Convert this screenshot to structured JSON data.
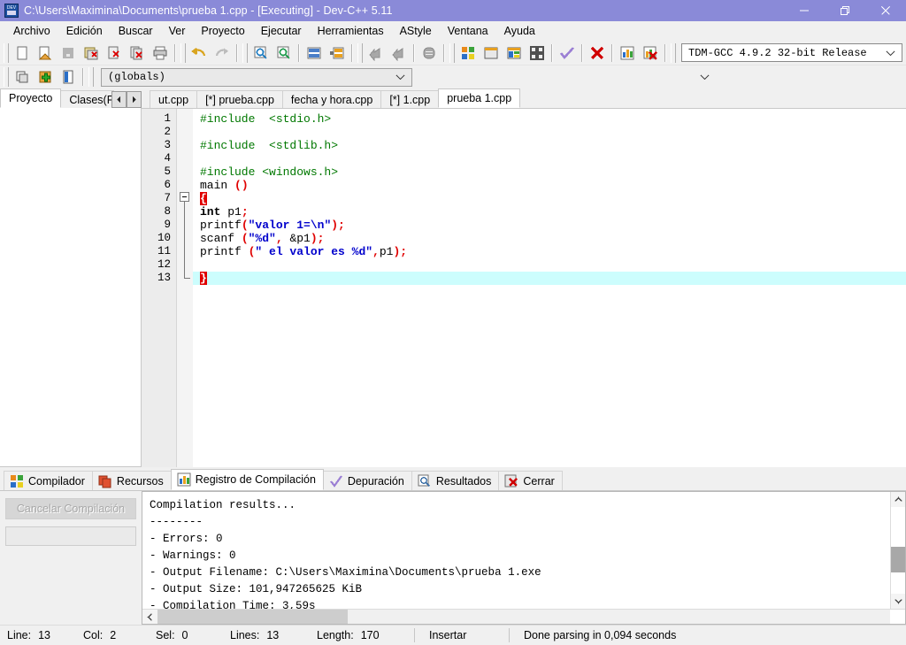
{
  "window": {
    "title": "C:\\Users\\Maximina\\Documents\\prueba 1.cpp - [Executing] - Dev-C++ 5.11",
    "icon": "devcpp-icon",
    "minimize": "minimize-button",
    "restore": "restore-button",
    "close": "close-button"
  },
  "menu": {
    "items": [
      {
        "label": "Archivo"
      },
      {
        "label": "Edición"
      },
      {
        "label": "Buscar"
      },
      {
        "label": "Ver"
      },
      {
        "label": "Proyecto"
      },
      {
        "label": "Ejecutar"
      },
      {
        "label": "Herramientas"
      },
      {
        "label": "AStyle"
      },
      {
        "label": "Ventana"
      },
      {
        "label": "Ayuda"
      }
    ]
  },
  "toolbar": {
    "buttons": [
      {
        "name": "new-file-icon",
        "enabled": true
      },
      {
        "name": "open-file-icon",
        "enabled": true
      },
      {
        "name": "save-file-icon",
        "enabled": false
      },
      {
        "name": "save-all-icon",
        "enabled": true
      },
      {
        "name": "close-file-icon",
        "enabled": true
      },
      {
        "name": "close-all-icon",
        "enabled": true
      },
      {
        "name": "print-icon",
        "enabled": true
      },
      {
        "name": "undo-icon",
        "enabled": true
      },
      {
        "name": "redo-icon",
        "enabled": false
      },
      {
        "name": "find-icon",
        "enabled": true
      },
      {
        "name": "replace-icon",
        "enabled": true
      },
      {
        "name": "goto-line-icon",
        "enabled": true
      },
      {
        "name": "goto-function-icon",
        "enabled": true
      },
      {
        "name": "back-icon",
        "enabled": false
      },
      {
        "name": "forward-icon",
        "enabled": false
      },
      {
        "name": "toggle-bookmark-icon",
        "enabled": false
      },
      {
        "name": "compile-icon",
        "enabled": true
      },
      {
        "name": "run-icon",
        "enabled": true
      },
      {
        "name": "compile-and-run-icon",
        "enabled": true
      },
      {
        "name": "rebuild-all-icon",
        "enabled": true
      },
      {
        "name": "syntax-check-icon",
        "enabled": true
      },
      {
        "name": "stop-execution-icon",
        "enabled": true
      },
      {
        "name": "profile-icon",
        "enabled": true
      },
      {
        "name": "delete-profile-icon",
        "enabled": true
      }
    ],
    "compiler_label": "TDM-GCC 4.9.2 32-bit Release",
    "compiler_arrow": "chevron-down-icon"
  },
  "toolbar2": {
    "buttons": [
      {
        "name": "new-project-icon"
      },
      {
        "name": "add-to-project-icon"
      },
      {
        "name": "project-options-icon"
      }
    ],
    "scope_label": "(globals)",
    "scope_arrow": "chevron-down-icon",
    "member_label": "",
    "member_arrow": "chevron-down-icon"
  },
  "left_panel": {
    "tabs": [
      {
        "label": "Proyecto",
        "active": true
      },
      {
        "label": "Clases(Fun",
        "active": false
      }
    ],
    "scroll_left": "◄",
    "scroll_right": "►"
  },
  "editor": {
    "tabs": [
      {
        "label": "ut.cpp",
        "active": false
      },
      {
        "label": "[*] prueba.cpp",
        "active": false
      },
      {
        "label": "fecha y hora.cpp",
        "active": false
      },
      {
        "label": "[*] 1.cpp",
        "active": false
      },
      {
        "label": "prueba 1.cpp",
        "active": true
      }
    ],
    "line_numbers": [
      "1",
      "2",
      "3",
      "4",
      "5",
      "6",
      "7",
      "8",
      "9",
      "10",
      "11",
      "12",
      "13"
    ],
    "lines": [
      {
        "n": 1,
        "current": false,
        "tokens": [
          {
            "t": "#include  <stdio.h>",
            "c": "kw-green"
          }
        ]
      },
      {
        "n": 2,
        "current": false,
        "tokens": []
      },
      {
        "n": 3,
        "current": false,
        "tokens": [
          {
            "t": "#include  <stdlib.h>",
            "c": "kw-green"
          }
        ]
      },
      {
        "n": 4,
        "current": false,
        "tokens": []
      },
      {
        "n": 5,
        "current": false,
        "tokens": [
          {
            "t": "#include <windows.h>",
            "c": "kw-green"
          }
        ]
      },
      {
        "n": 6,
        "current": false,
        "tokens": [
          {
            "t": "main ",
            "c": "kw-plain"
          },
          {
            "t": "()",
            "c": "kw-red"
          }
        ]
      },
      {
        "n": 7,
        "current": false,
        "tokens": [
          {
            "t": "{",
            "c": "brace-hl"
          }
        ]
      },
      {
        "n": 8,
        "current": false,
        "tokens": [
          {
            "t": "int",
            "c": "kw-black"
          },
          {
            "t": " p1",
            "c": "kw-plain"
          },
          {
            "t": ";",
            "c": "kw-red"
          }
        ]
      },
      {
        "n": 9,
        "current": false,
        "tokens": [
          {
            "t": "printf",
            "c": "kw-plain"
          },
          {
            "t": "(",
            "c": "kw-red"
          },
          {
            "t": "\"valor 1=\\n\"",
            "c": "kw-blue"
          },
          {
            "t": ");",
            "c": "kw-red"
          }
        ]
      },
      {
        "n": 10,
        "current": false,
        "tokens": [
          {
            "t": "scanf ",
            "c": "kw-plain"
          },
          {
            "t": "(",
            "c": "kw-red"
          },
          {
            "t": "\"%d\"",
            "c": "kw-blue"
          },
          {
            "t": ", ",
            "c": "kw-red"
          },
          {
            "t": "&p1",
            "c": "kw-plain"
          },
          {
            "t": ");",
            "c": "kw-red"
          }
        ]
      },
      {
        "n": 11,
        "current": false,
        "tokens": [
          {
            "t": "printf ",
            "c": "kw-plain"
          },
          {
            "t": "(",
            "c": "kw-red"
          },
          {
            "t": "\" el valor es %d\"",
            "c": "kw-blue"
          },
          {
            "t": ",",
            "c": "kw-red"
          },
          {
            "t": "p1",
            "c": "kw-plain"
          },
          {
            "t": ");",
            "c": "kw-red"
          }
        ]
      },
      {
        "n": 12,
        "current": false,
        "tokens": []
      },
      {
        "n": 13,
        "current": true,
        "tokens": [
          {
            "t": "}",
            "c": "brace-hl"
          }
        ]
      }
    ]
  },
  "bottom_panel": {
    "tabs": [
      {
        "label": "Compilador",
        "icon": "compiler-icon",
        "active": false
      },
      {
        "label": "Recursos",
        "icon": "resources-icon",
        "active": false
      },
      {
        "label": "Registro de Compilación",
        "icon": "compile-log-icon",
        "active": true
      },
      {
        "label": "Depuración",
        "icon": "debug-icon",
        "active": false
      },
      {
        "label": "Resultados",
        "icon": "results-icon",
        "active": false
      },
      {
        "label": "Cerrar",
        "icon": "close-panel-icon",
        "active": false
      }
    ],
    "cancel_button": "Cancelar Compilación",
    "log": [
      "Compilation results...",
      "--------",
      "- Errors: 0",
      "- Warnings: 0",
      "- Output Filename: C:\\Users\\Maximina\\Documents\\prueba 1.exe",
      "- Output Size: 101,947265625 KiB",
      "- Compilation Time: 3,59s"
    ],
    "scroll_up": "scroll-up-icon",
    "scroll_down": "scroll-down-icon",
    "scroll_left": "scroll-left-icon"
  },
  "statusbar": {
    "line_label": "Line:",
    "line_value": "13",
    "col_label": "Col:",
    "col_value": "2",
    "sel_label": "Sel:",
    "sel_value": "0",
    "lines_label": "Lines:",
    "lines_value": "13",
    "length_label": "Length:",
    "length_value": "170",
    "mode": "Insertar",
    "message": "Done parsing in 0,094 seconds"
  },
  "colors": {
    "titlebar": "#8a8ad8",
    "chrome": "#f0f0f0",
    "current_line": "#ccfdfd",
    "string": "#0000cc",
    "preprocessor": "#007800",
    "symbol": "#e00000",
    "brace_match_bg": "#e00000"
  }
}
